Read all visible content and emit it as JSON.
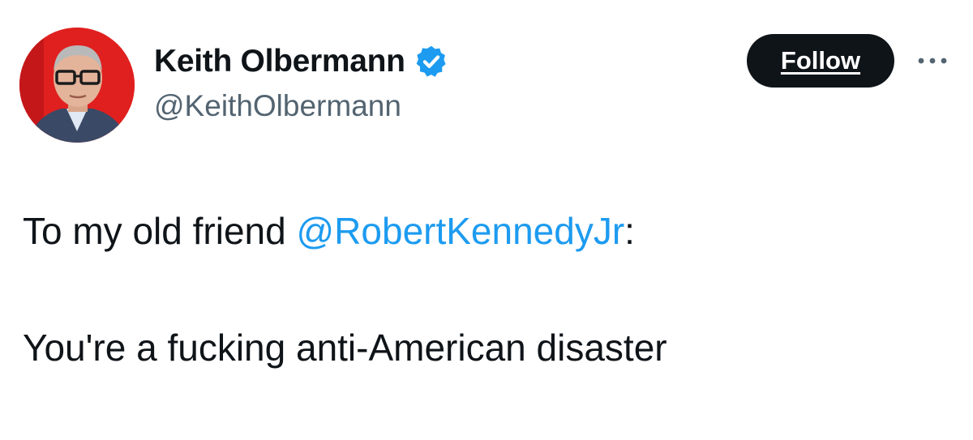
{
  "author": {
    "display_name": "Keith Olbermann",
    "handle": "@KeithOlbermann",
    "verified_icon": "verified-badge-icon",
    "avatar_background": "#e0201f"
  },
  "actions": {
    "follow_label": "Follow",
    "more_icon": "more-options-icon"
  },
  "tweet": {
    "line1_prefix": "To my old friend ",
    "mention": "@RobertKennedyJr",
    "line1_suffix": ":",
    "line2": "You're a fucking anti-American disaster"
  },
  "colors": {
    "text": "#0f1419",
    "secondary": "#536471",
    "link": "#1d9bf0",
    "verified": "#1d9bf0",
    "follow_bg": "#0f1419"
  }
}
